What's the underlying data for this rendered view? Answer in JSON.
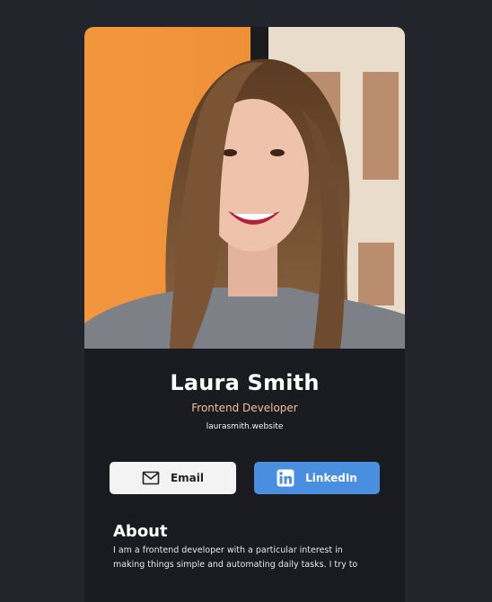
{
  "profile": {
    "name": "Laura Smith",
    "title": "Frontend Developer",
    "website": "laurasmith.website"
  },
  "buttons": {
    "email_label": "Email",
    "linkedin_label": "LinkedIn"
  },
  "about": {
    "heading": "About",
    "text": "I am a frontend developer with a particular interest in making things simple and automating daily tasks. I try to"
  },
  "icons": {
    "email": "mail-icon",
    "linkedin": "linkedin-icon"
  },
  "colors": {
    "background": "#23252c",
    "card": "#1a1b21",
    "accent": "#f3bf99",
    "linkedin": "#4a8fdf",
    "email_button": "#f3f3f3"
  }
}
